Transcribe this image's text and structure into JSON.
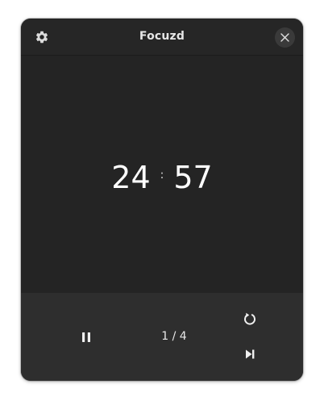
{
  "window": {
    "title": "Focuzd"
  },
  "header": {
    "settings_icon": "gear-icon",
    "close_icon": "close-icon"
  },
  "timer": {
    "minutes": "24",
    "separator": ":",
    "seconds": "57"
  },
  "controls": {
    "pause_icon": "pause-icon",
    "round_counter": "1 / 4",
    "reset_icon": "reset-icon",
    "skip_icon": "skip-next-icon"
  },
  "colors": {
    "window_bg": "#242424",
    "controls_bg": "#2e2e2e",
    "text": "#ffffff"
  }
}
